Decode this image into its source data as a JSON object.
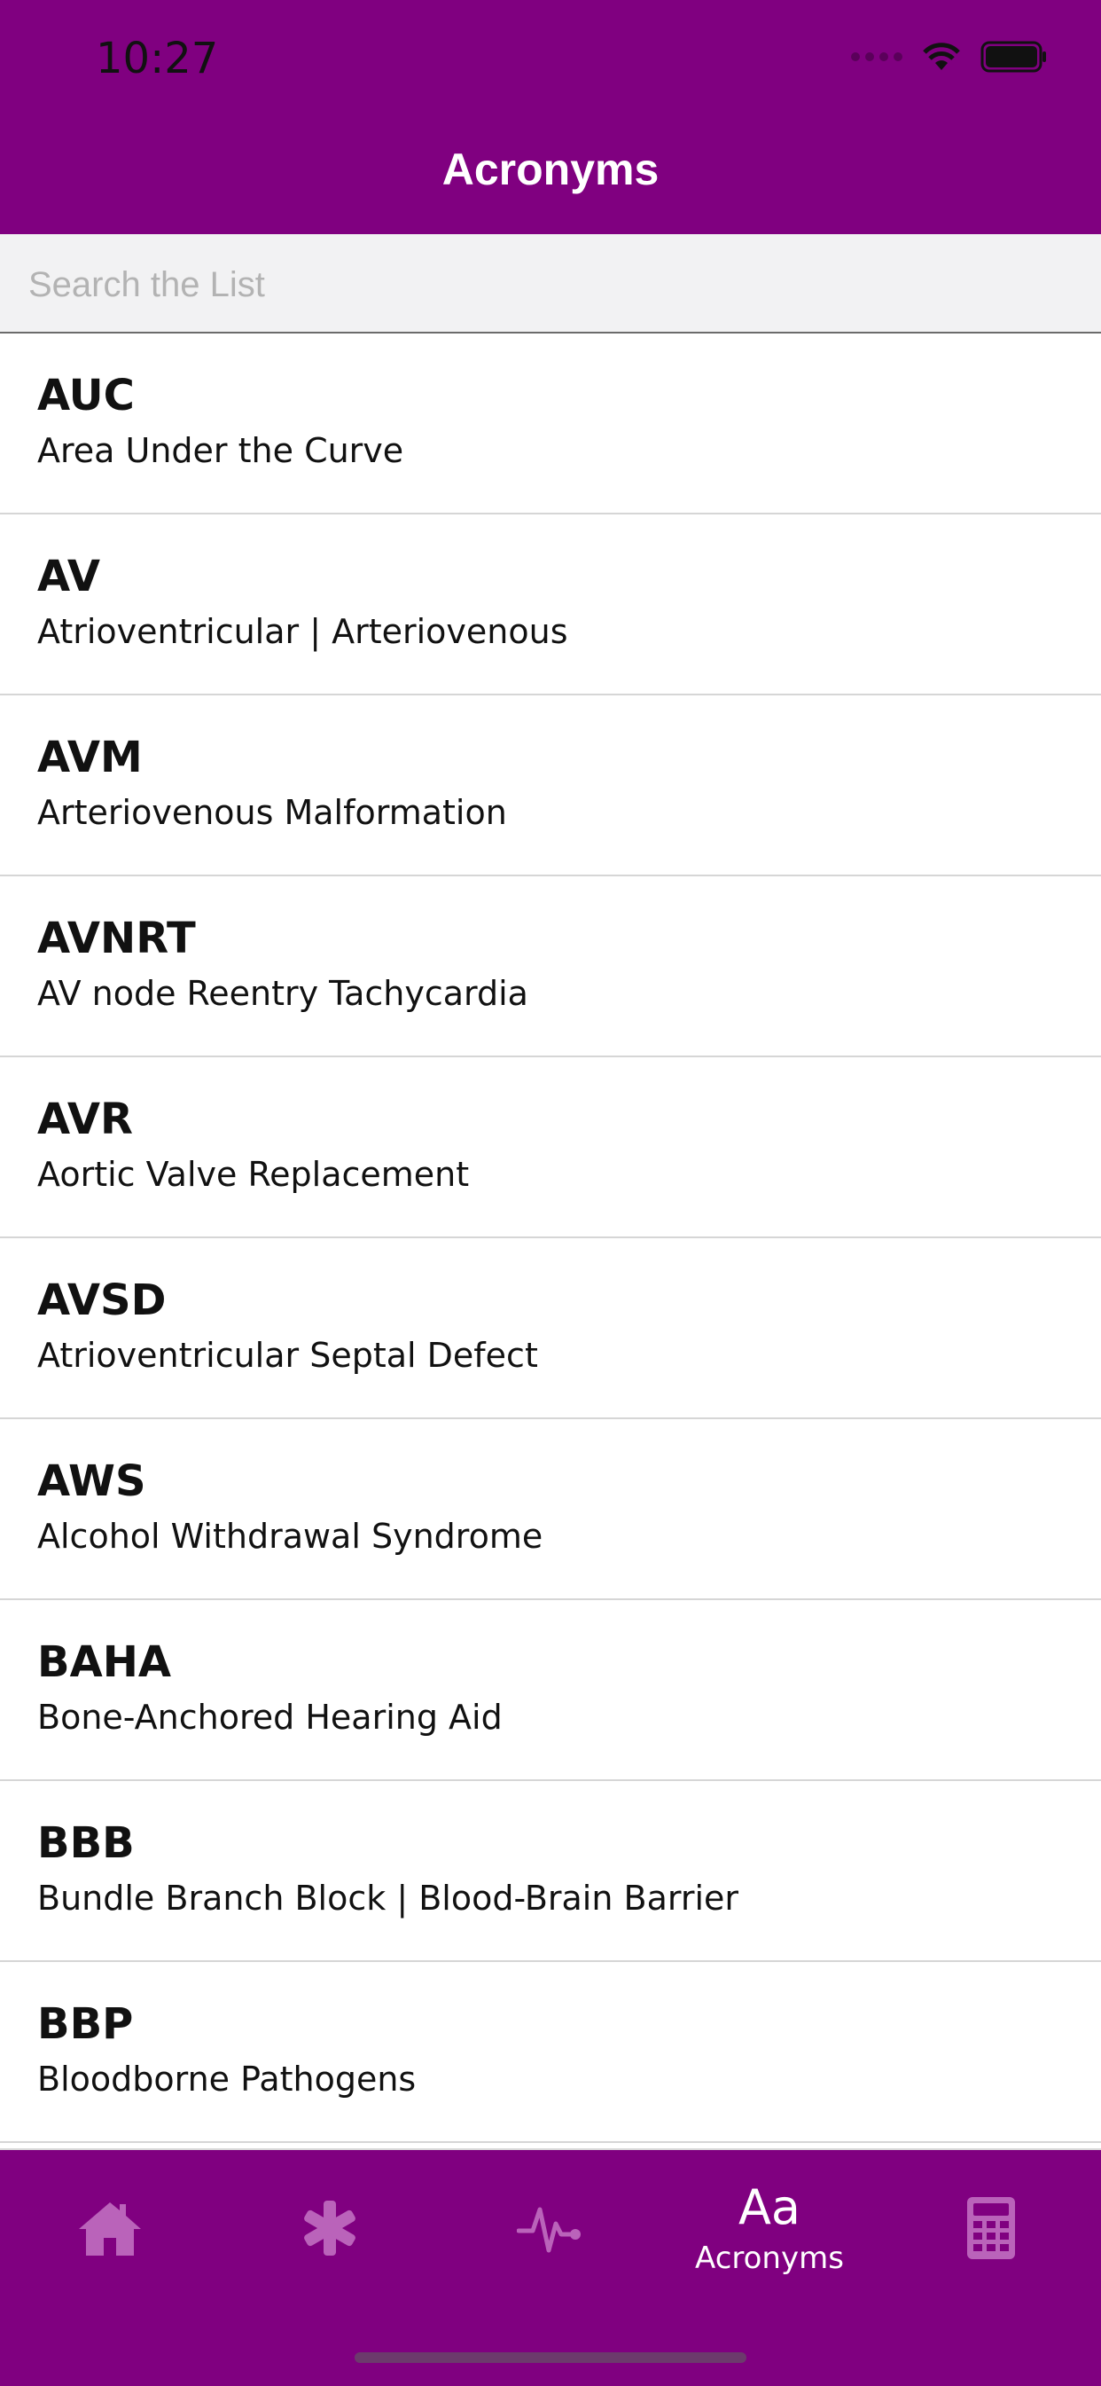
{
  "status_bar": {
    "time": "10:27"
  },
  "header": {
    "title": "Acronyms"
  },
  "search": {
    "placeholder": "Search the List",
    "value": ""
  },
  "items": [
    {
      "acronym": "AUC",
      "definition": "Area Under the Curve"
    },
    {
      "acronym": "AV",
      "definition": "Atrioventricular | Arteriovenous"
    },
    {
      "acronym": "AVM",
      "definition": "Arteriovenous Malformation"
    },
    {
      "acronym": "AVNRT",
      "definition": "AV node Reentry Tachycardia"
    },
    {
      "acronym": "AVR",
      "definition": "Aortic Valve Replacement"
    },
    {
      "acronym": "AVSD",
      "definition": "Atrioventricular Septal Defect"
    },
    {
      "acronym": "AWS",
      "definition": "Alcohol Withdrawal Syndrome"
    },
    {
      "acronym": "BAHA",
      "definition": "Bone-Anchored Hearing Aid"
    },
    {
      "acronym": "BBB",
      "definition": "Bundle Branch Block | Blood-Brain Barrier"
    },
    {
      "acronym": "BBP",
      "definition": "Bloodborne Pathogens"
    }
  ],
  "tabbar": {
    "tabs": [
      {
        "icon": "home-icon",
        "label": ""
      },
      {
        "icon": "asterisk-icon",
        "label": ""
      },
      {
        "icon": "heartbeat-icon",
        "label": ""
      },
      {
        "icon": "acronyms-icon",
        "glyph": "Aa",
        "label": "Acronyms",
        "active": true
      },
      {
        "icon": "calculator-icon",
        "label": ""
      }
    ]
  },
  "colors": {
    "brand": "#800080",
    "inactive_icon": "#ba63ba",
    "separator": "#d6d6d6"
  }
}
